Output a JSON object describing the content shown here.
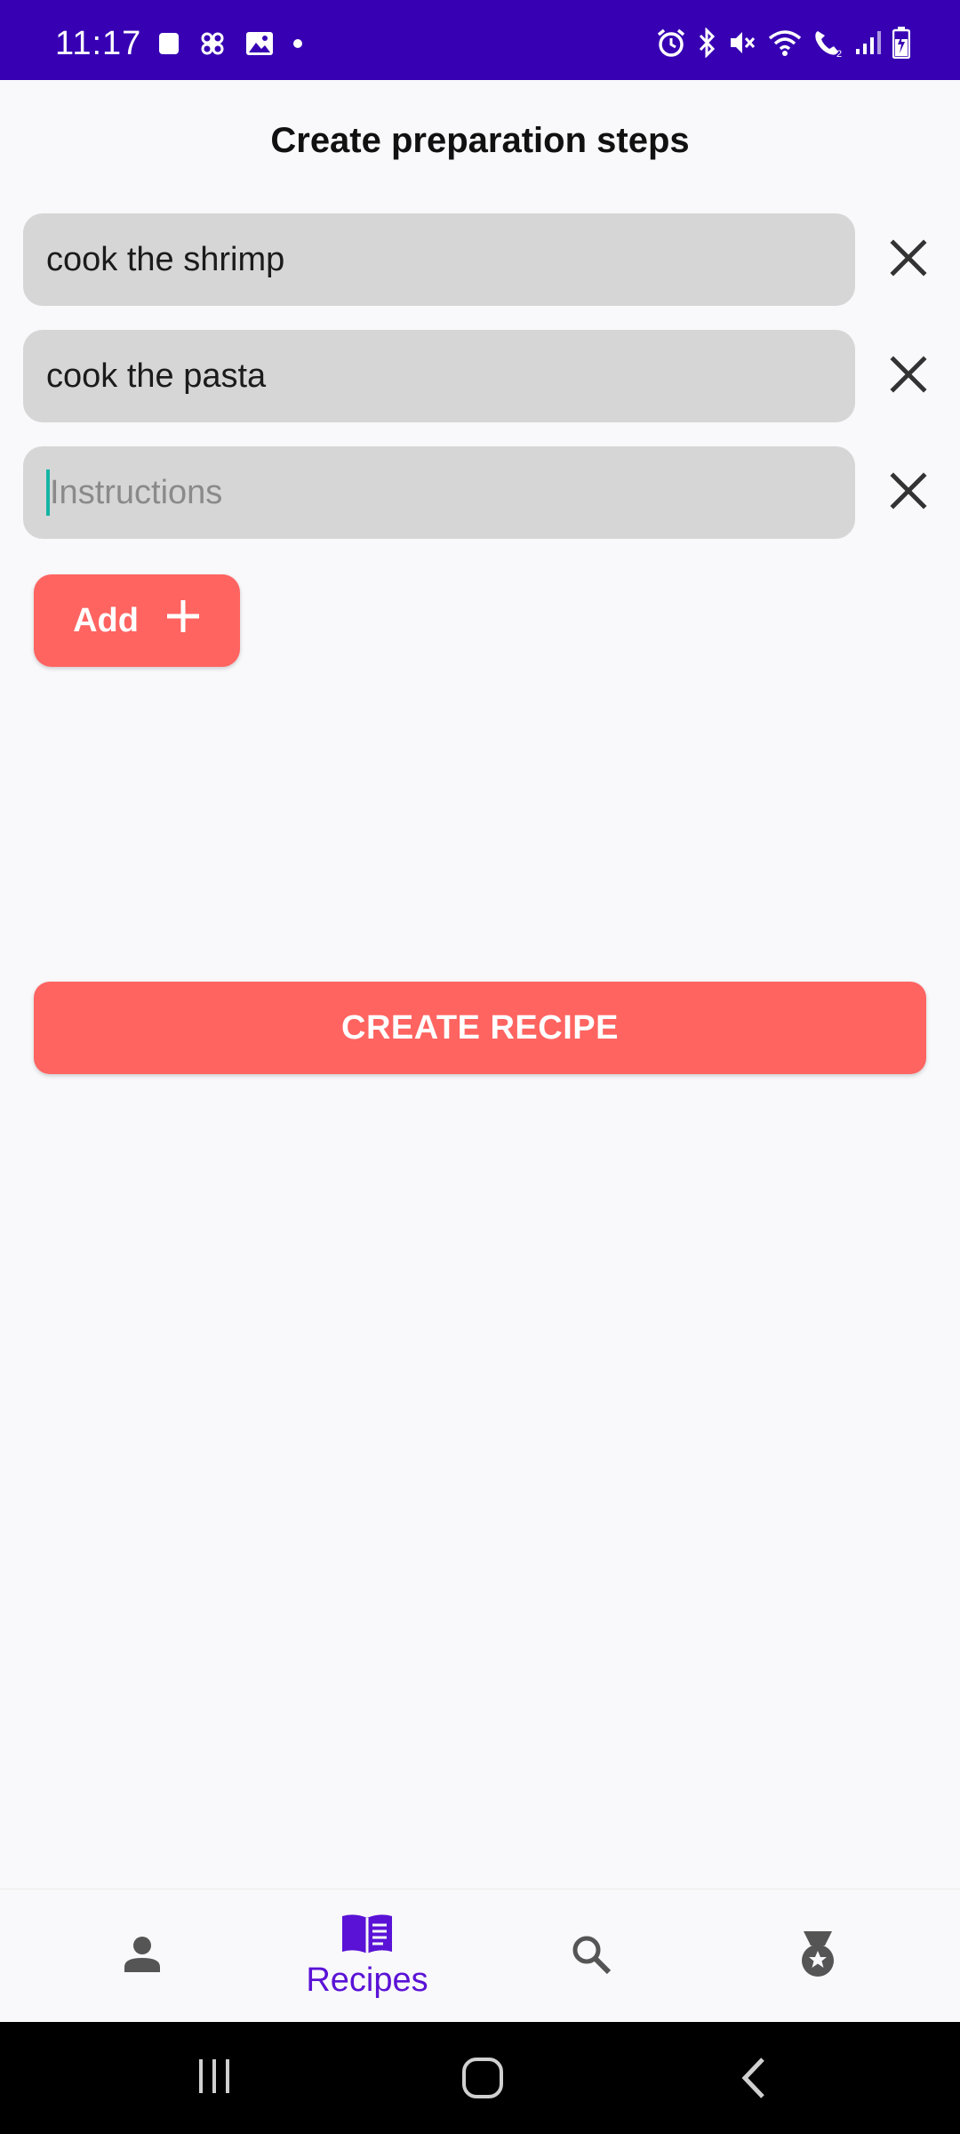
{
  "status_bar": {
    "time": "11:17",
    "left_icons": [
      "stop-icon",
      "pinwheel-icon",
      "image-icon",
      "dot-icon"
    ],
    "right_icons": [
      "alarm-icon",
      "bluetooth-icon",
      "mute-icon",
      "wifi-icon",
      "wifi-calling-icon",
      "signal-icon",
      "battery-icon"
    ],
    "background": "#3700b3"
  },
  "header": {
    "title": "Create preparation steps"
  },
  "steps": [
    {
      "value": "cook the shrimp",
      "remove_icon": "close-icon"
    },
    {
      "value": "cook the pasta",
      "remove_icon": "close-icon"
    },
    {
      "value": "",
      "placeholder": "Instructions",
      "remove_icon": "close-icon"
    }
  ],
  "add_button": {
    "label": "Add",
    "icon": "plus-icon"
  },
  "create_button": {
    "label": "CREATE RECIPE"
  },
  "colors": {
    "accent": "#ff6461",
    "nav_active": "#5a12d6",
    "field_bg": "#d6d6d6"
  },
  "bottom_nav": {
    "items": [
      {
        "icon": "person-icon",
        "label": ""
      },
      {
        "icon": "recipe-book-icon",
        "label": "Recipes",
        "active": true
      },
      {
        "icon": "search-icon",
        "label": ""
      },
      {
        "icon": "medal-icon",
        "label": ""
      }
    ]
  },
  "system_nav": {
    "buttons": [
      "recents-icon",
      "home-icon",
      "back-icon"
    ]
  }
}
